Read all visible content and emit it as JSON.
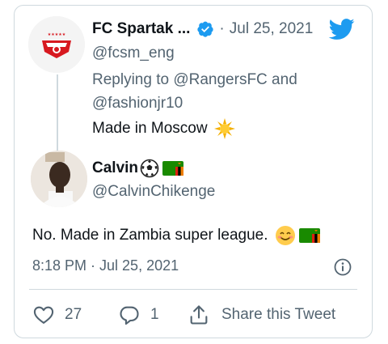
{
  "reply": {
    "name": "FC Spartak ...",
    "separator": "·",
    "date": "Jul 25, 2021",
    "handle": "@fcsm_eng",
    "replying_prefix": "Replying to ",
    "replying_user1": "@RangersFC",
    "replying_and": " and ",
    "replying_user2": "@fashionjr10",
    "text": "Made in Moscow",
    "emoji": "sun-emoji"
  },
  "tweet": {
    "name": "Calvin",
    "name_emojis": [
      "soccer-ball-emoji",
      "zambia-flag-emoji"
    ],
    "handle": "@CalvinChikenge",
    "text": "No. Made in Zambia super league.",
    "text_emojis": [
      "smiling-face-emoji",
      "zambia-flag-emoji"
    ],
    "time": "8:18 PM · Jul 25, 2021"
  },
  "actions": {
    "like_count": "27",
    "reply_count": "1",
    "share_label": "Share this Tweet"
  },
  "colors": {
    "text": "#0f1419",
    "secondary": "#536471",
    "border": "#cfd9de",
    "twitter_blue": "#1d9bf0",
    "spartak_red": "#d71920"
  }
}
